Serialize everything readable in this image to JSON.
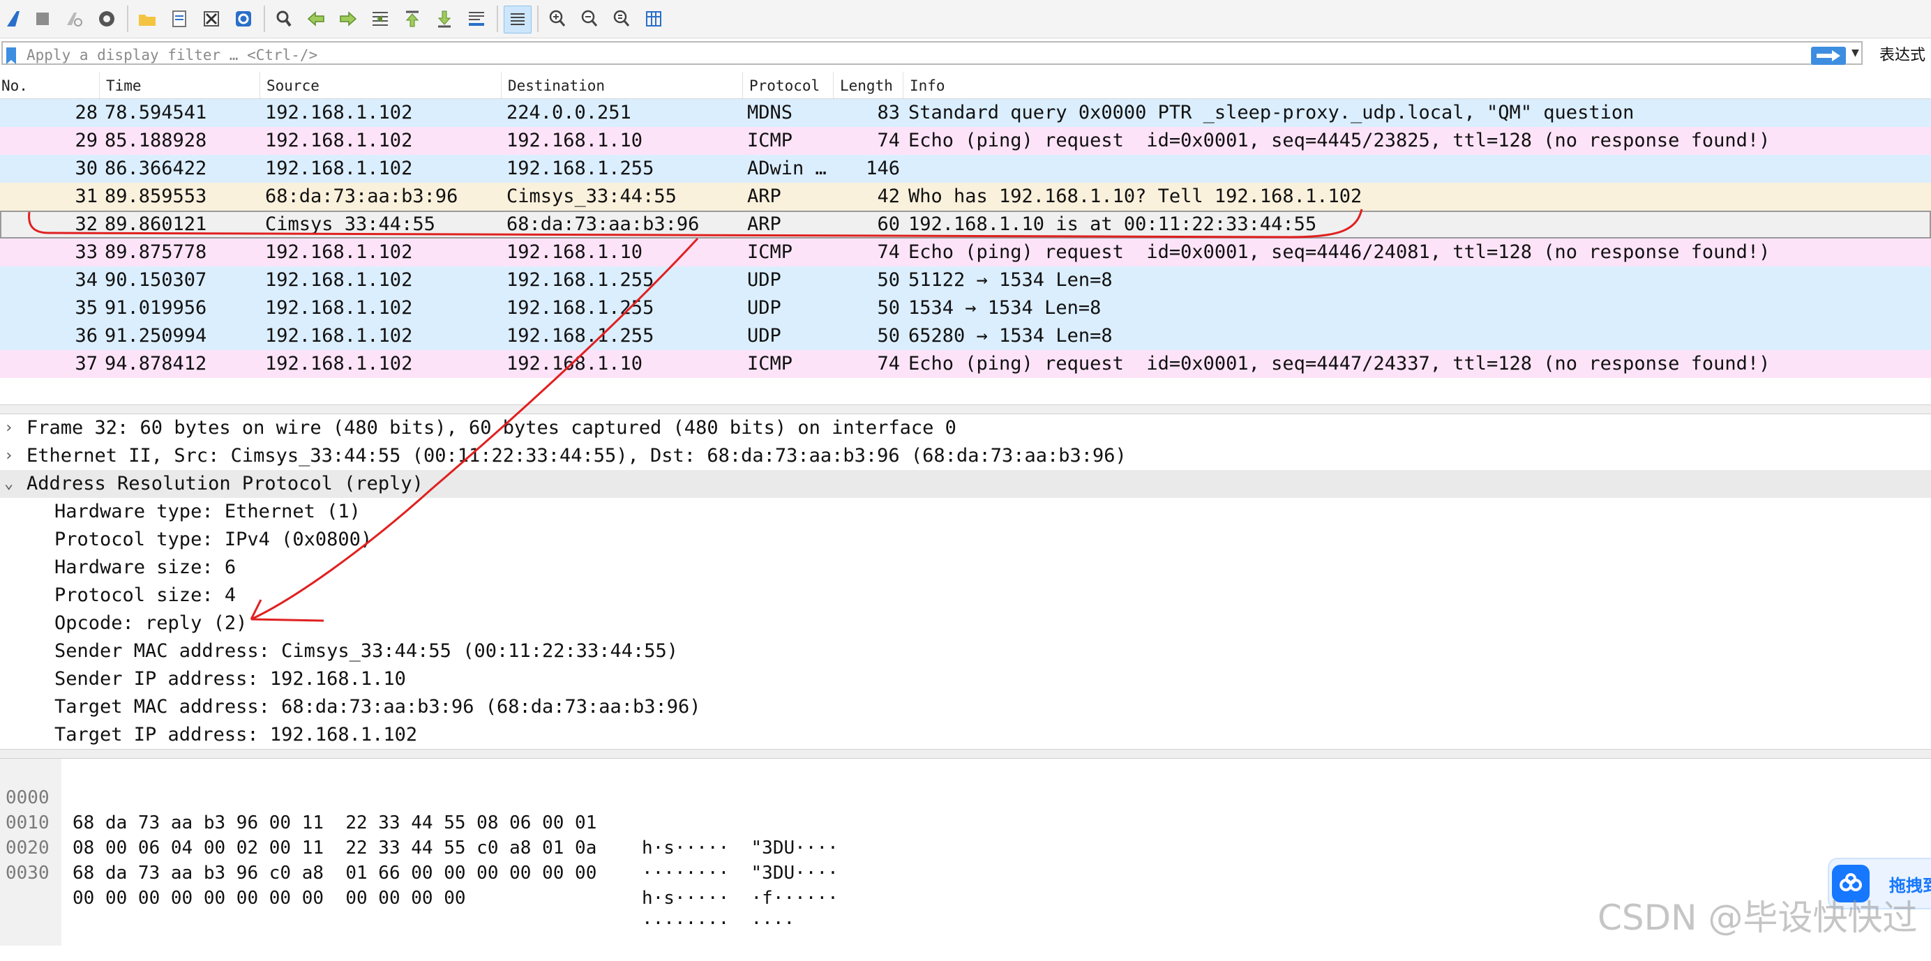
{
  "toolbar": {
    "buttons": [
      "shark-fin-icon",
      "stop-icon",
      "restart-icon",
      "options-gear-icon",
      "open-folder-icon",
      "save-file-icon",
      "close-file-icon",
      "reload-icon",
      "find-icon",
      "back-arrow-icon",
      "forward-arrow-icon",
      "go-to-packet-icon",
      "first-packet-icon",
      "last-packet-icon",
      "auto-scroll-icon",
      "colorize-icon",
      "zoom-in-icon",
      "zoom-out-icon",
      "zoom-normal-icon",
      "resize-columns-icon"
    ]
  },
  "filter": {
    "placeholder": "Apply a display filter … <Ctrl-/>",
    "expression_label": "表达式"
  },
  "columns": [
    "No.",
    "Time",
    "Source",
    "Destination",
    "Protocol",
    "Length",
    "Info"
  ],
  "packets": [
    {
      "no": "28",
      "time": "78.594541",
      "src": "192.168.1.102",
      "dst": "224.0.0.251",
      "proto": "MDNS",
      "len": "83",
      "info": "Standard query 0x0000 PTR _sleep-proxy._udp.local, \"QM\" question",
      "color": "#dbeefe"
    },
    {
      "no": "29",
      "time": "85.188928",
      "src": "192.168.1.102",
      "dst": "192.168.1.10",
      "proto": "ICMP",
      "len": "74",
      "info": "Echo (ping) request  id=0x0001, seq=4445/23825, ttl=128 (no response found!)",
      "color": "#fde3f8"
    },
    {
      "no": "30",
      "time": "86.366422",
      "src": "192.168.1.102",
      "dst": "192.168.1.255",
      "proto": "ADwin …",
      "len": "146",
      "info": "",
      "color": "#dbeefe"
    },
    {
      "no": "31",
      "time": "89.859553",
      "src": "68:da:73:aa:b3:96",
      "dst": "Cimsys_33:44:55",
      "proto": "ARP",
      "len": "42",
      "info": "Who has 192.168.1.10? Tell 192.168.1.102",
      "color": "#faf1dc"
    },
    {
      "no": "32",
      "time": "89.860121",
      "src": "Cimsys_33:44:55",
      "dst": "68:da:73:aa:b3:96",
      "proto": "ARP",
      "len": "60",
      "info": "192.168.1.10 is at 00:11:22:33:44:55",
      "color": "#f0f0f0"
    },
    {
      "no": "33",
      "time": "89.875778",
      "src": "192.168.1.102",
      "dst": "192.168.1.10",
      "proto": "ICMP",
      "len": "74",
      "info": "Echo (ping) request  id=0x0001, seq=4446/24081, ttl=128 (no response found!)",
      "color": "#fde3f8"
    },
    {
      "no": "34",
      "time": "90.150307",
      "src": "192.168.1.102",
      "dst": "192.168.1.255",
      "proto": "UDP",
      "len": "50",
      "info": "51122 → 1534 Len=8",
      "color": "#dbeefe"
    },
    {
      "no": "35",
      "time": "91.019956",
      "src": "192.168.1.102",
      "dst": "192.168.1.255",
      "proto": "UDP",
      "len": "50",
      "info": "1534 → 1534 Len=8",
      "color": "#dbeefe"
    },
    {
      "no": "36",
      "time": "91.250994",
      "src": "192.168.1.102",
      "dst": "192.168.1.255",
      "proto": "UDP",
      "len": "50",
      "info": "65280 → 1534 Len=8",
      "color": "#dbeefe"
    },
    {
      "no": "37",
      "time": "94.878412",
      "src": "192.168.1.102",
      "dst": "192.168.1.10",
      "proto": "ICMP",
      "len": "74",
      "info": "Echo (ping) request  id=0x0001, seq=4447/24337, ttl=128 (no response found!)",
      "color": "#fde3f8"
    }
  ],
  "details": [
    {
      "arrow": "›",
      "text": "Frame 32: 60 bytes on wire (480 bits), 60 bytes captured (480 bits) on interface 0",
      "level": 0
    },
    {
      "arrow": "›",
      "text": "Ethernet II, Src: Cimsys_33:44:55 (00:11:22:33:44:55), Dst: 68:da:73:aa:b3:96 (68:da:73:aa:b3:96)",
      "level": 0
    },
    {
      "arrow": "⌄",
      "text": "Address Resolution Protocol (reply)",
      "level": 0,
      "selected": true
    },
    {
      "arrow": "",
      "text": "Hardware type: Ethernet (1)",
      "level": 1
    },
    {
      "arrow": "",
      "text": "Protocol type: IPv4 (0x0800)",
      "level": 1
    },
    {
      "arrow": "",
      "text": "Hardware size: 6",
      "level": 1
    },
    {
      "arrow": "",
      "text": "Protocol size: 4",
      "level": 1
    },
    {
      "arrow": "",
      "text": "Opcode: reply (2)",
      "level": 1
    },
    {
      "arrow": "",
      "text": "Sender MAC address: Cimsys_33:44:55 (00:11:22:33:44:55)",
      "level": 1
    },
    {
      "arrow": "",
      "text": "Sender IP address: 192.168.1.10",
      "level": 1
    },
    {
      "arrow": "",
      "text": "Target MAC address: 68:da:73:aa:b3:96 (68:da:73:aa:b3:96)",
      "level": 1
    },
    {
      "arrow": "",
      "text": "Target IP address: 192.168.1.102",
      "level": 1
    }
  ],
  "hex": [
    {
      "offset": "0000",
      "bytes_a": "68 da 73 aa b3 96 00 11  22 33 44 55 08 06 00 01",
      "ascii": "h·s·····  \"3DU····"
    },
    {
      "offset": "0010",
      "bytes_a": "08 00 06 04 00 02 00 11  22 33 44 55 c0 a8 01 0a",
      "ascii": "········  \"3DU····"
    },
    {
      "offset": "0020",
      "bytes_a": "68 da 73 aa b3 96 c0 a8  01 66 00 00 00 00 00 00",
      "ascii": "h·s·····  ·f······"
    },
    {
      "offset": "0030",
      "bytes_a": "00 00 00 00 00 00 00 00  00 00 00 00",
      "ascii": "········  ····"
    }
  ],
  "widget": {
    "label": "拖拽到"
  },
  "watermark": "CSDN @毕设快快过",
  "colors": {
    "selected_row": "#f0f0f0",
    "accent": "#3d8ee0",
    "annotation": "#e02020"
  }
}
